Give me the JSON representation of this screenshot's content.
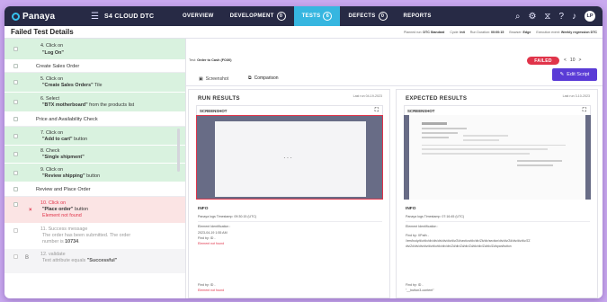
{
  "app": {
    "name": "Panaya",
    "project": "S4 CLOUD DTC"
  },
  "nav": {
    "items": [
      {
        "label": "OVERVIEW"
      },
      {
        "label": "DEVELOPMENT",
        "badge": "0"
      },
      {
        "label": "TESTS",
        "badge": "6",
        "active": true
      },
      {
        "label": "DEFECTS",
        "badge": "0"
      },
      {
        "label": "REPORTS"
      }
    ],
    "icons": [
      "search-icon",
      "settings-icon",
      "hourglass-icon",
      "help-icon",
      "bell-icon"
    ],
    "avatar": "LP"
  },
  "header": {
    "title": "Failed Test Details",
    "meta": [
      {
        "label": "Planned run:",
        "value": "DTC Standard"
      },
      {
        "label": "Cycle:",
        "value": "Init"
      },
      {
        "label": "Run Duration:",
        "value": "00:00:15"
      },
      {
        "label": "Browser:",
        "value": "Edge"
      },
      {
        "label": "Execution event:",
        "value": "Weekly regression DTC"
      }
    ]
  },
  "steps": [
    {
      "kind": "pass",
      "num": "4. Click on",
      "text": "\"Log On\""
    },
    {
      "kind": "group",
      "text": "Create Sales Order"
    },
    {
      "kind": "pass",
      "num": "5. Click on",
      "text": "\"Create Sales Orders\"",
      "suffix": " Tile"
    },
    {
      "kind": "pass",
      "num": "6. Select",
      "text": "\"BTX motherboard\"",
      "suffix": " from the products list"
    },
    {
      "kind": "group",
      "text": "Price and Availability Check"
    },
    {
      "kind": "pass",
      "num": "7. Click on",
      "text": "\"Add to cart\"",
      "suffix": " button"
    },
    {
      "kind": "pass",
      "num": "8. Check",
      "text": "\"Single shipment\""
    },
    {
      "kind": "pass",
      "num": "9. Click on",
      "text": "\"Review shipping\"",
      "suffix": " button"
    },
    {
      "kind": "group",
      "text": "Review and Place Order"
    },
    {
      "kind": "fail",
      "num": "10. Click on",
      "text": "\"Place order\"",
      "suffix": " button",
      "error": "Element not found"
    },
    {
      "kind": "pending",
      "num": "11. Success message",
      "line2": "The order has been submitted. The order",
      "line3_pre": "number is ",
      "line3_bold": "10734",
      "line3_post": "."
    },
    {
      "kind": "gray",
      "num": "12. validate",
      "line2": "Text attribute equals ",
      "line2_bold": "\"Successful\"",
      "tag": "B"
    }
  ],
  "detail": {
    "test_label": "Test:",
    "test_name": "Order to Cash (FO30)",
    "status": "FAILED",
    "pager": {
      "prev": "<",
      "current": "10",
      "next": ">"
    },
    "edit_button": "Edit Script",
    "tabs": [
      {
        "label": "Screenshot",
        "icon": "image-icon"
      },
      {
        "label": "Comparison",
        "icon": "compare-icon",
        "active": true
      }
    ],
    "run": {
      "title": "RUN RESULTS",
      "last_run": "Last run 04-19-2023",
      "shot_label": "SCREENSHOT",
      "info_title": "INFO",
      "timestamp": "Panaya logs Timestamp: 09:30:15 (UTC)",
      "element_label": "Element Identification :",
      "date_line": "2023-04-19 1:55 AM",
      "find_by": "Find by: ID -",
      "not_found": "Element not found",
      "find_by2": "Find by: ID -",
      "not_found2": "Element not found"
    },
    "expected": {
      "title": "EXPECTED RESULTS",
      "last_run": "Last run 3-10-2023",
      "shot_label": "SCREENSHOT",
      "info_title": "INFO",
      "timestamp": "Panaya logs Timestamp: 07:16:45 (UTC)",
      "element_label": "Element Identification :",
      "find_by": "Find by: XPath -",
      "xpath1": "//em/body/div/div/div/div/div/div/div/div/Zd/section/div/div/Zb/div/section/div/div/Zd/div/div/div/ZZ",
      "xpath2": "div/Zd/div/div/div/div/div/div/div/div/Zd/div/Zd/div/Zd/div/div/Zd/div/Zd/span/button",
      "find_by2": "Find by: ID -",
      "content": "\"__button3-content\""
    }
  },
  "colors": {
    "nav_bg": "#272a45",
    "active_tab": "#36b6e0",
    "pass_bg": "#d9f2df",
    "fail_bg": "#fbe4e4",
    "fail_red": "#e0344a",
    "edit_purple": "#5a3bd6",
    "page_bg": "#c9a9ef"
  }
}
